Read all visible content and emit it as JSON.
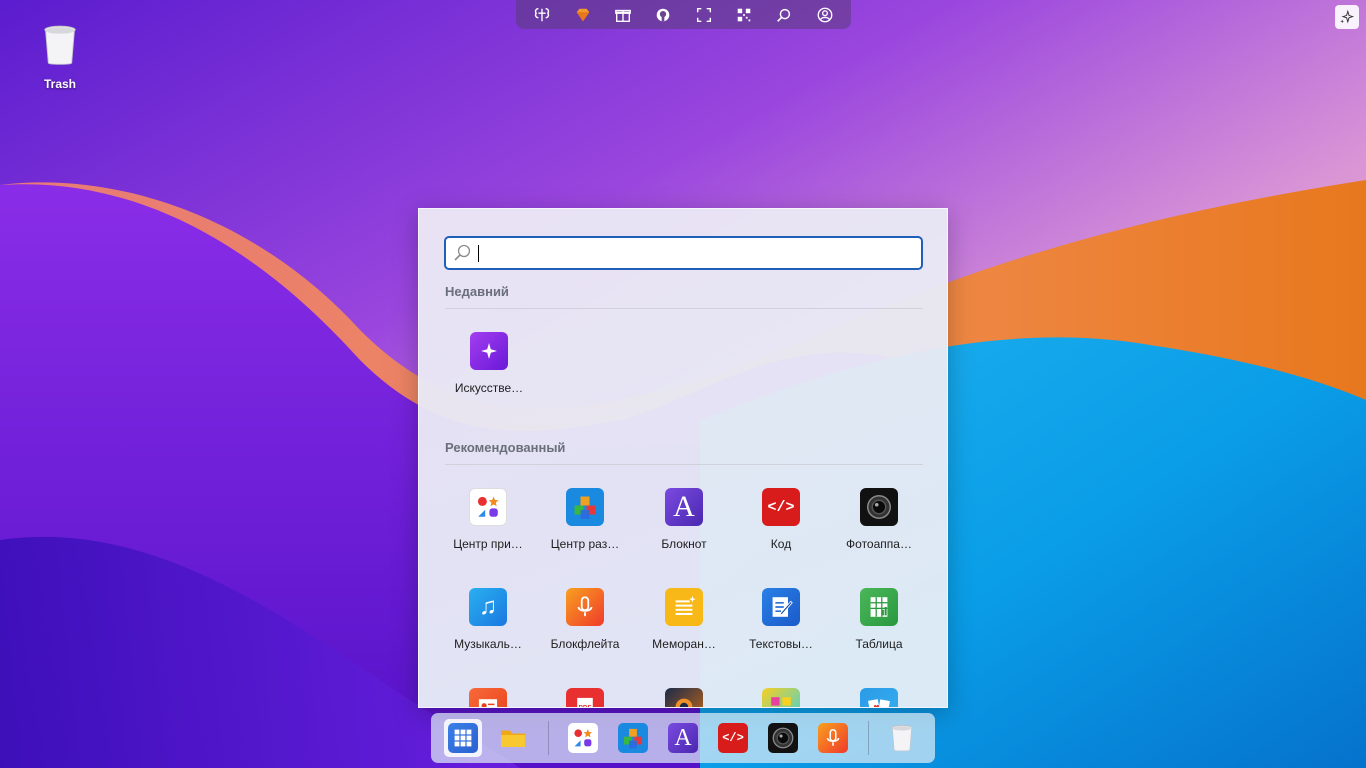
{
  "desktop": {
    "trash_label": "Trash"
  },
  "topbar": {
    "items": [
      "ai-brain-icon",
      "gem-icon",
      "gift-icon",
      "github-icon",
      "fullscreen-icon",
      "qr-code-icon",
      "search-icon",
      "account-icon"
    ]
  },
  "start_menu": {
    "search": {
      "value": "",
      "placeholder": ""
    },
    "recent_title": "Недавний",
    "recent": [
      {
        "label": "Искусстве…",
        "icon": "ai-sparkle-icon"
      }
    ],
    "recommended_title": "Рекомендованный",
    "recommended": [
      {
        "label": "Центр при…",
        "icon": "app-center-icon"
      },
      {
        "label": "Центр раз…",
        "icon": "dev-center-cubes-icon"
      },
      {
        "label": "Блокнот",
        "icon": "notepad-letter-a-icon"
      },
      {
        "label": "Код",
        "icon": "code-icon"
      },
      {
        "label": "Фотоаппа…",
        "icon": "camera-icon"
      },
      {
        "label": "Музыкаль…",
        "icon": "music-note-icon"
      },
      {
        "label": "Блокфлейта",
        "icon": "microphone-icon"
      },
      {
        "label": "Меморан…",
        "icon": "memo-icon"
      },
      {
        "label": "Текстовы…",
        "icon": "text-editor-icon"
      },
      {
        "label": "Таблица",
        "icon": "spreadsheet-icon"
      },
      {
        "label": "",
        "icon": "presentation-icon"
      },
      {
        "label": "",
        "icon": "pdf-icon"
      },
      {
        "label": "",
        "icon": "game-icon"
      },
      {
        "label": "",
        "icon": "puzzle-icon"
      },
      {
        "label": "",
        "icon": "cards-icon"
      }
    ]
  },
  "dock": {
    "items": [
      "app-grid-icon",
      "folder-icon",
      "app-center-icon",
      "dev-center-cubes-icon",
      "notepad-letter-a-icon",
      "code-icon",
      "camera-icon",
      "microphone-icon",
      "trash-icon"
    ]
  },
  "colors": {
    "accent": "#1f5fb8",
    "menu_bg": "#e8e9f4",
    "ai_purple": "#8a2be2"
  }
}
